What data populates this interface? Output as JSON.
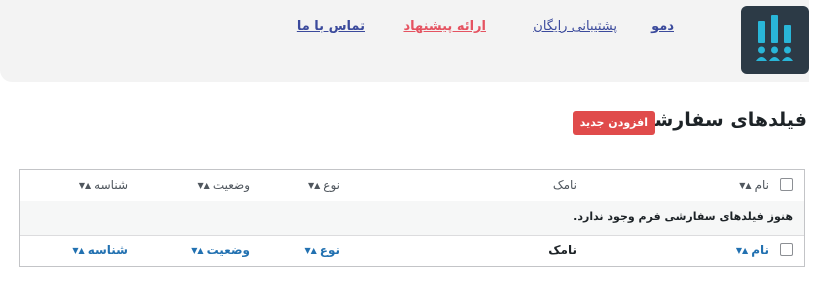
{
  "header": {
    "logo_label": "logo",
    "nav": {
      "demo": "دمو",
      "support": "پشتیبانی رایگان",
      "offer": "ارائه پیشنهاد",
      "contact": "تماس با ما"
    }
  },
  "page": {
    "title": "فیلدهای سفارشی",
    "add_new_label": "افزودن جدید"
  },
  "table": {
    "columns": {
      "name": "نام",
      "form_name": "نامک",
      "type": "نوع",
      "status": "وضعیت",
      "id": "شناسه"
    },
    "sort_glyph": "▲▼",
    "empty_message": "هنوز فیلدهای سفارشی فرم وجود ندارد."
  },
  "colors": {
    "accent": "#e04b4b",
    "link": "#2271b1",
    "logo_bg": "#2c3a46",
    "logo_icon": "#29b6d8"
  },
  "icons": {
    "logo": "poll-audience-icon",
    "sort": "sort-icon",
    "checkbox": "checkbox-icon"
  }
}
